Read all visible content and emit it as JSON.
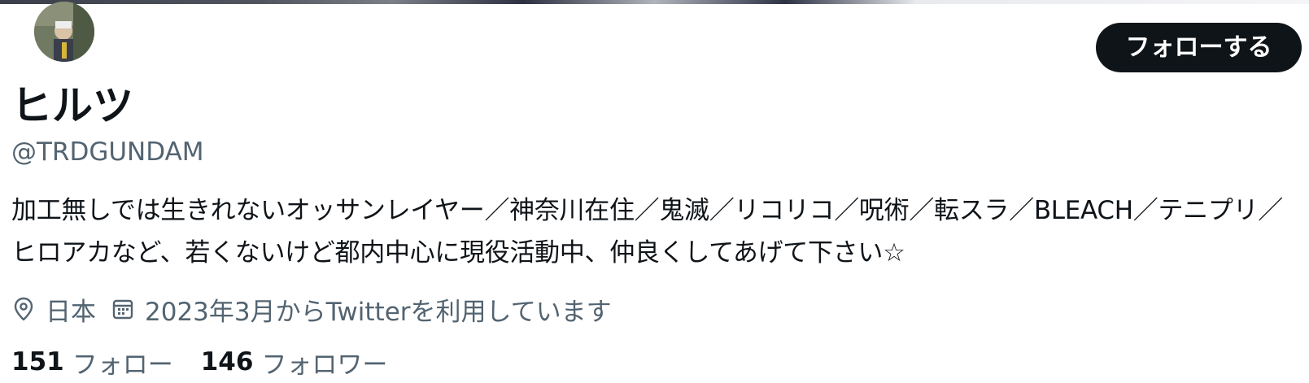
{
  "profile": {
    "display_name": "ヒルツ",
    "handle": "@TRDGUNDAM",
    "follow_button_label": "フォローする",
    "bio": "加工無しでは生きれないオッサンレイヤー／神奈川在住／鬼滅／リコリコ／呪術／転スラ／BLEACH／テニプリ／ヒロアカなど、若くないけど都内中心に現役活動中、仲良くしてあげて下さい☆",
    "location": "日本",
    "joined": "2023年3月からTwitterを利用しています",
    "following_count": "151",
    "following_label": "フォロー",
    "followers_count": "146",
    "followers_label": "フォロワー"
  },
  "icons": {
    "location": "location-pin-icon",
    "joined": "calendar-icon"
  },
  "colors": {
    "text_primary": "#0f1419",
    "text_secondary": "#536471",
    "button_bg": "#0f1419",
    "button_text": "#ffffff",
    "background": "#ffffff"
  }
}
